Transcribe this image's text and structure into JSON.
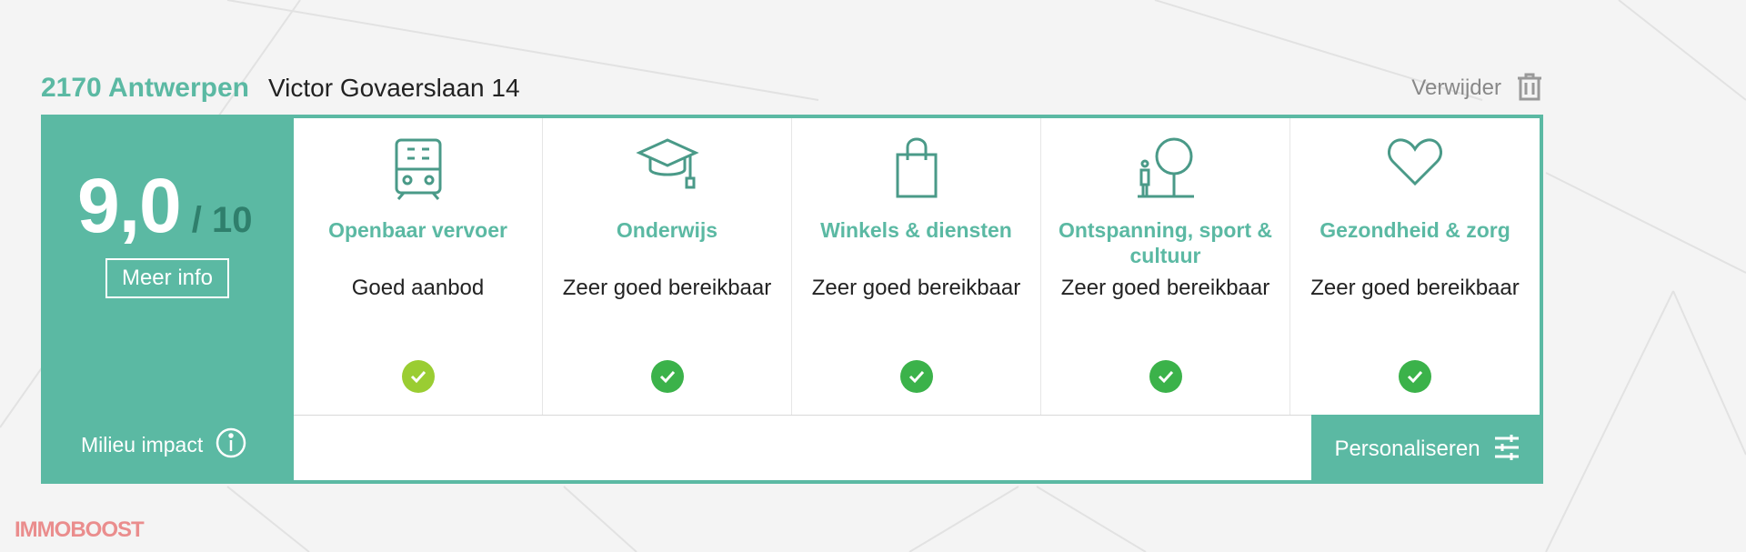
{
  "header": {
    "city": "2170 Antwerpen",
    "street": "Victor Govaerslaan 14",
    "delete_label": "Verwijder",
    "delete_icon": "trash-icon"
  },
  "score": {
    "value": "9,0",
    "max": "/ 10",
    "more_info_label": "Meer info"
  },
  "categories": [
    {
      "title": "Openbaar vervoer",
      "text": "Goed aanbod",
      "icon": "bus-icon",
      "status_color": "#9acd32"
    },
    {
      "title": "Onderwijs",
      "text": "Zeer goed bereikbaar",
      "icon": "graduation-cap-icon",
      "status_color": "#3bb24a"
    },
    {
      "title": "Winkels & diensten",
      "text": "Zeer goed bereikbaar",
      "icon": "shopping-bag-icon",
      "status_color": "#3bb24a"
    },
    {
      "title": "Ontspanning, sport & cultuur",
      "text": "Zeer goed bereikbaar",
      "icon": "park-icon",
      "status_color": "#3bb24a"
    },
    {
      "title": "Gezondheid & zorg",
      "text": "Zeer goed bereikbaar",
      "icon": "heart-icon",
      "status_color": "#3bb24a"
    }
  ],
  "footer": {
    "milieu_label": "Milieu impact",
    "milieu_icon": "info-icon",
    "personalize_label": "Personaliseren",
    "personalize_icon": "sliders-icon"
  },
  "brand": "IMMOBOOST",
  "colors": {
    "accent": "#5bb9a3",
    "accent_dark": "#2f7f6c",
    "check_good": "#3bb24a",
    "check_ok": "#9acd32"
  }
}
